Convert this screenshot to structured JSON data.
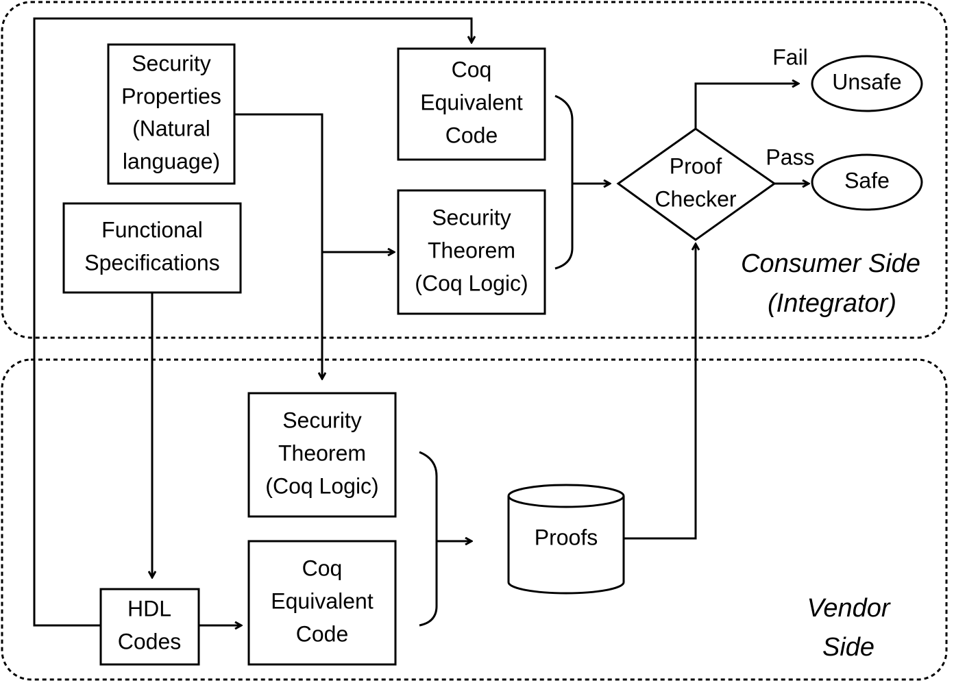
{
  "regions": {
    "consumer": [
      "Consumer Side",
      "(Integrator)"
    ],
    "vendor": [
      "Vendor",
      "Side"
    ]
  },
  "nodes": {
    "security_properties": [
      "Security",
      "Properties",
      "(Natural",
      "language)"
    ],
    "functional_specifications": [
      "Functional",
      "Specifications"
    ],
    "coq_code_top": [
      "Coq",
      "Equivalent",
      "Code"
    ],
    "security_theorem_top": [
      "Security",
      "Theorem",
      "(Coq Logic)"
    ],
    "proof_checker": [
      "Proof",
      "Checker"
    ],
    "unsafe": "Unsafe",
    "safe": "Safe",
    "security_theorem_bottom": [
      "Security",
      "Theorem",
      "(Coq Logic)"
    ],
    "coq_code_bottom": [
      "Coq",
      "Equivalent",
      "Code"
    ],
    "hdl_codes": [
      "HDL",
      "Codes"
    ],
    "proofs": "Proofs"
  },
  "edge_labels": {
    "fail": "Fail",
    "pass": "Pass"
  }
}
